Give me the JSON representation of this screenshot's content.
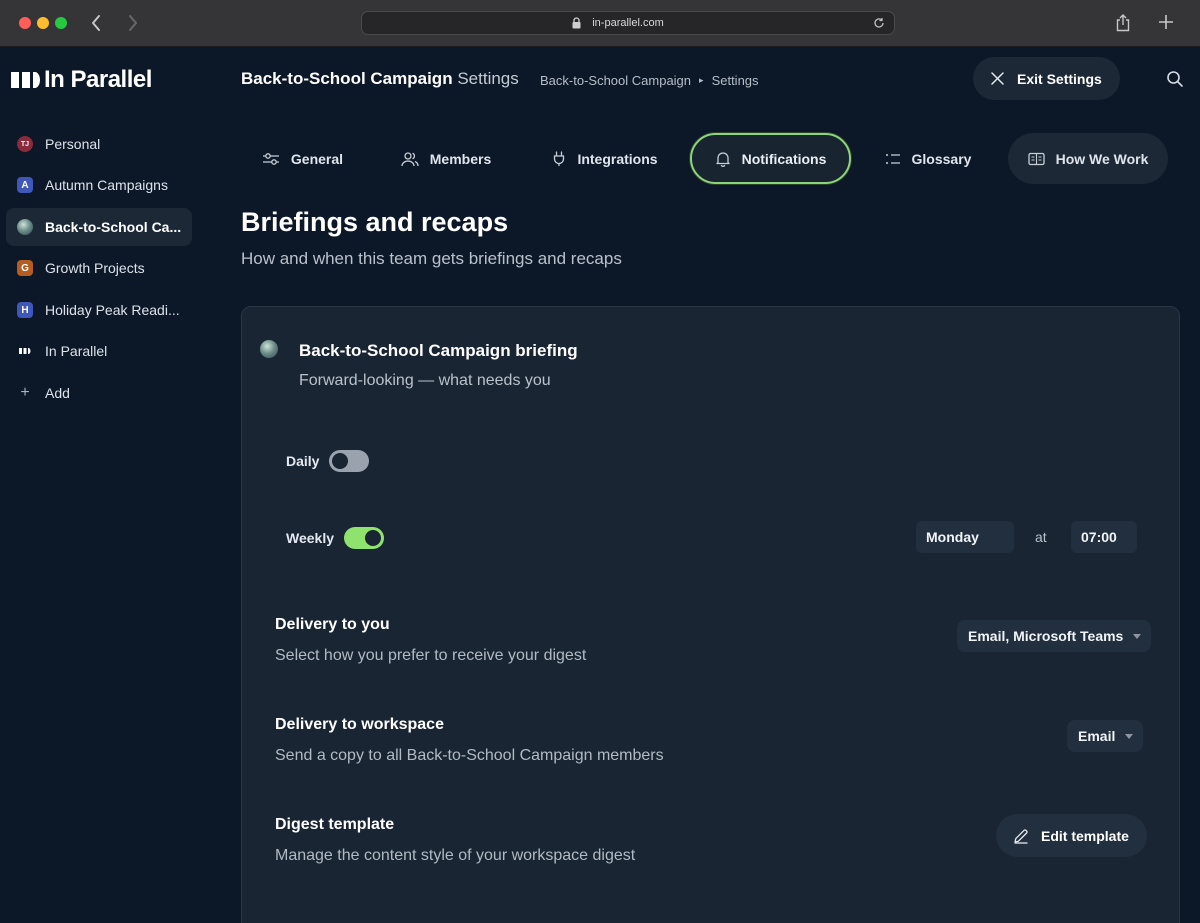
{
  "browser": {
    "url": "in-parallel.com"
  },
  "app": {
    "logo_text": "In Parallel"
  },
  "sidebar": {
    "items": [
      {
        "badge": "TJ",
        "badge_color": "#8b2a3a",
        "label": "Personal",
        "icon": "avatar-icon"
      },
      {
        "badge": "A",
        "badge_color": "#3f57b8",
        "label": "Autumn Campaigns",
        "icon": "letter-badge"
      },
      {
        "badge": "",
        "badge_color": "#6f8f8a",
        "label": "Back-to-School Ca...",
        "icon": "globe-avatar",
        "active": true
      },
      {
        "badge": "G",
        "badge_color": "#b35d23",
        "label": "Growth Projects",
        "icon": "letter-badge"
      },
      {
        "badge": "H",
        "badge_color": "#3f57b8",
        "label": "Holiday Peak Readi...",
        "icon": "letter-badge"
      },
      {
        "badge": "",
        "badge_color": "#ffffff",
        "label": "In Parallel",
        "icon": "logo-mark-icon"
      },
      {
        "badge": "+",
        "badge_color": "",
        "label": "Add",
        "icon": "plus-icon"
      }
    ]
  },
  "header": {
    "title_strong": "Back-to-School Campaign",
    "title_muted": "Settings",
    "breadcrumb": [
      "Back-to-School Campaign",
      "Settings"
    ],
    "exit_label": "Exit Settings"
  },
  "tabs": [
    {
      "label": "General",
      "icon": "sliders-icon"
    },
    {
      "label": "Members",
      "icon": "users-icon"
    },
    {
      "label": "Integrations",
      "icon": "plug-icon"
    },
    {
      "label": "Notifications",
      "icon": "bell-icon",
      "active": true
    },
    {
      "label": "Glossary",
      "icon": "list-icon"
    },
    {
      "label": "How We Work",
      "icon": "book-icon"
    }
  ],
  "section": {
    "title": "Briefings and recaps",
    "subtitle": "How and when this team gets briefings and recaps"
  },
  "card": {
    "title": "Back-to-School Campaign briefing",
    "subtitle": "Forward-looking — what needs you",
    "daily": {
      "label": "Daily",
      "on": false
    },
    "weekly": {
      "label": "Weekly",
      "on": true,
      "day": "Monday",
      "at": "at",
      "time": "07:00"
    },
    "delivery_you": {
      "title": "Delivery to you",
      "subtitle": "Select how you prefer to receive your digest",
      "value": "Email, Microsoft Teams"
    },
    "delivery_workspace": {
      "title": "Delivery to workspace",
      "subtitle": "Send a copy to all Back-to-School Campaign members",
      "value": "Email"
    },
    "digest": {
      "title": "Digest template",
      "subtitle": "Manage the content style of your workspace digest",
      "button": "Edit template"
    }
  },
  "colors": {
    "accent_green": "#8ee26d",
    "background": "#0c1727",
    "card": "#1a2533"
  }
}
